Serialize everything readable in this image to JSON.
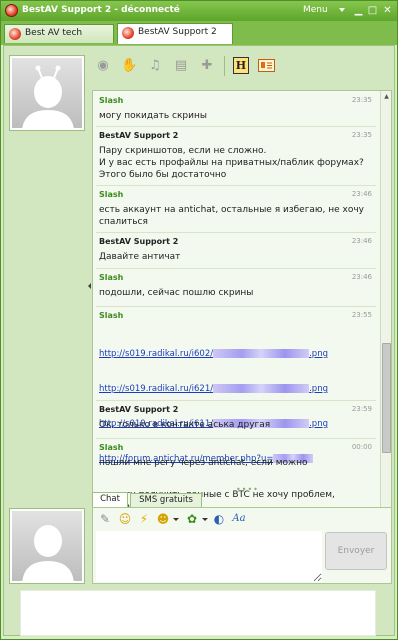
{
  "window": {
    "title": "BestAV Support 2 - déconnecté",
    "menu_label": "Menu"
  },
  "tabs": [
    {
      "label": "Best AV tech"
    },
    {
      "label": "BestAV Support 2"
    }
  ],
  "toolbar": {
    "icons": [
      "webcam-icon",
      "microphone-icon",
      "games-icon",
      "files-icon",
      "gamepad-icon",
      "history-icon",
      "contact-card-icon"
    ],
    "history_glyph": "H"
  },
  "messages": [
    {
      "from": "Slash",
      "time": "23:35",
      "text": "могу покидать скрины"
    },
    {
      "from": "BestAV Support 2",
      "time": "23:35",
      "text": "Пару скриншотов, если не сложно.\nИ у вас есть профайлы на приватных/паблик форумах?\nЭтого было бы достаточно"
    },
    {
      "from": "Slash",
      "time": "23:46",
      "text": "есть аккаунт на antichat, остальные я избегаю, не хочу\nспалиться"
    },
    {
      "from": "BestAV Support 2",
      "time": "23:46",
      "text": "Давайте античат"
    },
    {
      "from": "Slash",
      "time": "23:46",
      "text": "подошли, сейчас пошлю скрины"
    },
    {
      "from": "Slash",
      "time": "23:55",
      "links": [
        {
          "prefix": "http://s019.radikal.ru/i602/",
          "suffix": ".png"
        },
        {
          "prefix": "http://s019.radikal.ru/i621/",
          "suffix": ".png"
        },
        {
          "prefix": "http://s019.radikal.ru/i611/",
          "suffix": ".png"
        },
        {
          "prefix": "http://forum.antichat.ru/member.php?u=",
          "suffix": ""
        }
      ],
      "text": "не могу получить данные с BTC не хочу проблем, надеюсь\nна понимание"
    },
    {
      "from": "BestAV Support 2",
      "time": "23:59",
      "text": "Ок, только в контакте аська другая"
    },
    {
      "from": "Slash",
      "time": "00:00",
      "text": "пошли мне регу через antichat, если можно"
    }
  ],
  "input": {
    "tabs": [
      "Chat",
      "SMS gratuits"
    ],
    "send_label": "Envoyer",
    "emote_icons": [
      "format-icon",
      "smiley-icon",
      "wink-icon",
      "emoticon-pack-icon",
      "nudge-icon",
      "font-icon"
    ]
  },
  "colors": {
    "accent": "#6fb33c",
    "slash_name": "#3a8a1e",
    "link": "#1a3dbf"
  }
}
